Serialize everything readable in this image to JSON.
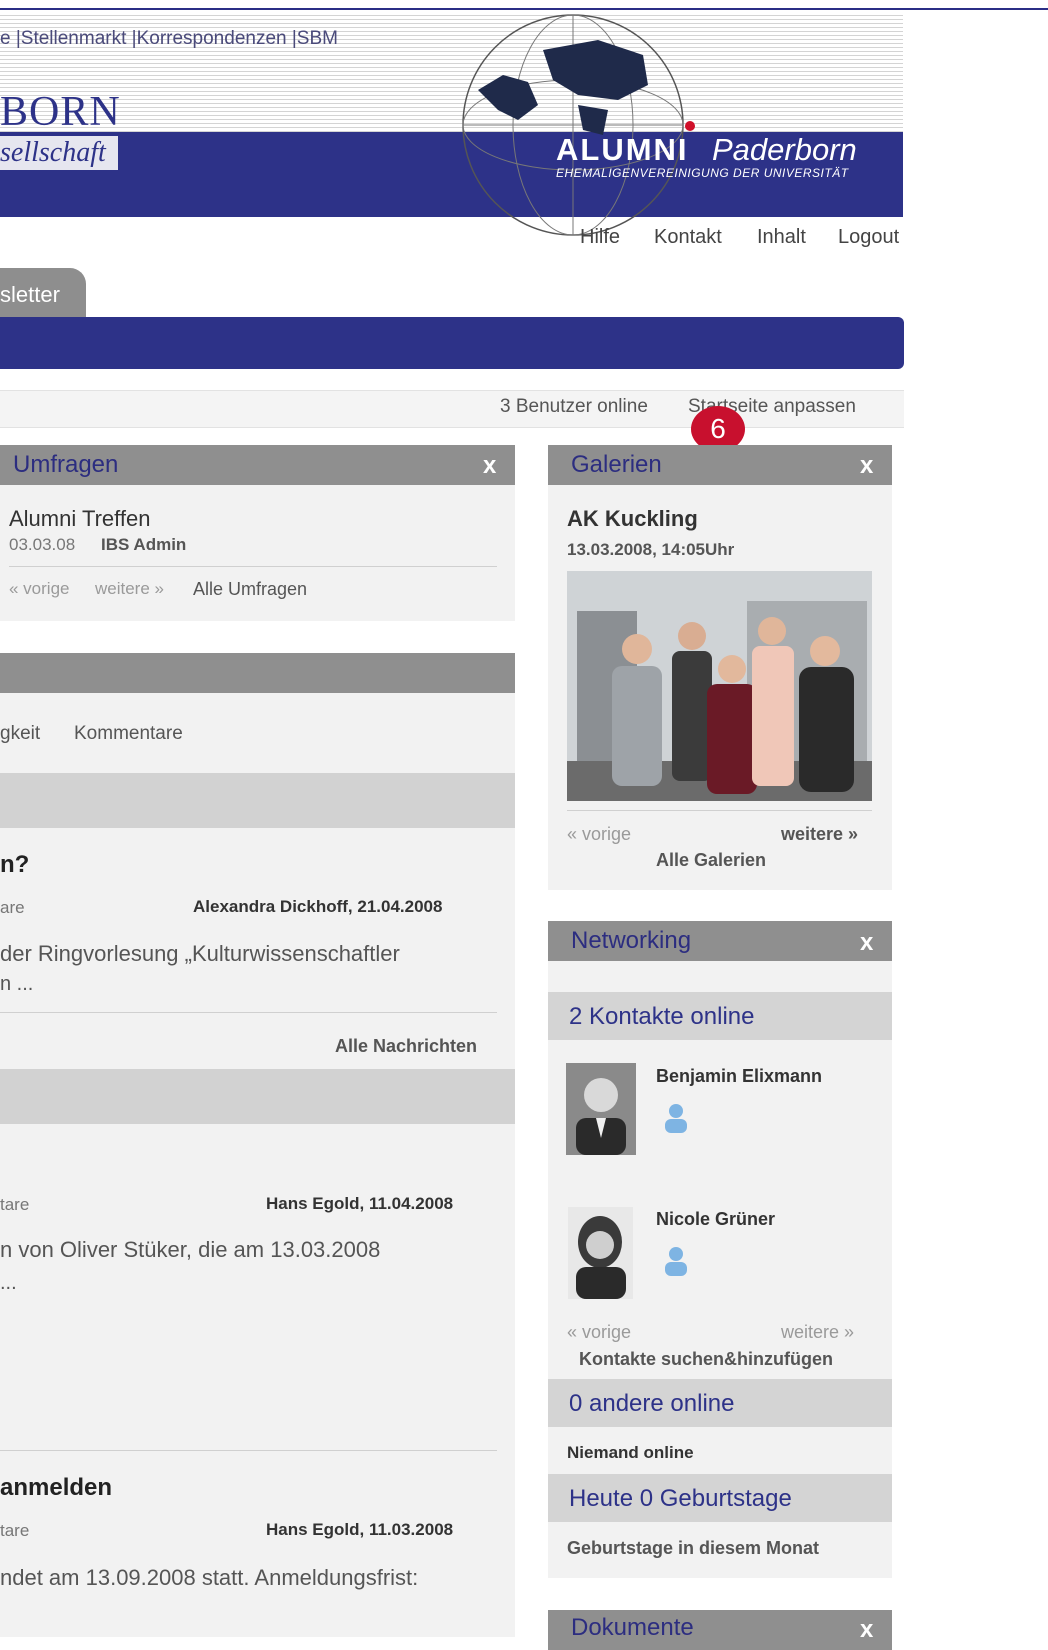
{
  "header": {
    "topnav": "e |Stellenmarkt |Korrespondenzen |SBM",
    "brand_line1": "BORN",
    "brand_line2": "sellschaft",
    "logo_word1": "ALUMNI",
    "logo_word2": "Paderborn",
    "logo_subtitle": "EHEMALIGENVEREINIGUNG DER UNIVERSITÄT"
  },
  "util_nav": {
    "help": "Hilfe",
    "contact": "Kontakt",
    "content": "Inhalt",
    "logout": "Logout"
  },
  "tabs": {
    "newsletter": "sletter"
  },
  "status": {
    "users_online": "3 Benutzer online",
    "customize": "Startseite anpassen",
    "badge": "6"
  },
  "polls": {
    "title": "Umfragen",
    "close": "x",
    "item_title": "Alumni Treffen",
    "item_date": "03.03.08",
    "item_author": "IBS Admin",
    "prev": "« vorige",
    "next": "weitere »",
    "all": "Alle Umfragen"
  },
  "news": {
    "sort_activity": "gkeit",
    "sort_comments": "Kommentare",
    "item1": {
      "title": "n?",
      "meta_left": "are",
      "author_date": "Alexandra Dickhoff, 21.04.2008",
      "text_line1": "der Ringvorlesung „Kulturwissenschaftler",
      "text_line2": "n ..."
    },
    "all": "Alle Nachrichten",
    "item2": {
      "meta_left": "tare",
      "author_date": "Hans Egold, 11.04.2008",
      "text_line1": "n von Oliver Stüker, die am 13.03.2008",
      "text_line2": "..."
    },
    "item3": {
      "title": "anmelden",
      "meta_left": "tare",
      "author_date": "Hans Egold, 11.03.2008",
      "text_line1": "ndet am 13.09.2008 statt. Anmeldungsfrist:"
    }
  },
  "gallery": {
    "title": "Galerien",
    "close": "x",
    "album": "AK Kuckling",
    "datetime": "13.03.2008, 14:05Uhr",
    "prev": "« vorige",
    "next": "weitere »",
    "all": "Alle Galerien"
  },
  "networking": {
    "title": "Networking",
    "close": "x",
    "contacts_online": "2 Kontakte online",
    "contact1": "Benjamin Elixmann",
    "contact2": "Nicole Grüner",
    "prev": "« vorige",
    "next": "weitere »",
    "search": "Kontakte suchen&hinzufügen",
    "others_online": "0 andere online",
    "nobody": "Niemand online",
    "birthdays_today": "Heute 0 Geburtstage",
    "birthdays_month": "Geburtstage in diesem Monat"
  },
  "documents": {
    "title": "Dokumente",
    "close": "x"
  },
  "colors": {
    "brand_blue": "#2d3288",
    "panel_head": "#8f8f8f",
    "badge_red": "#c8102e"
  }
}
